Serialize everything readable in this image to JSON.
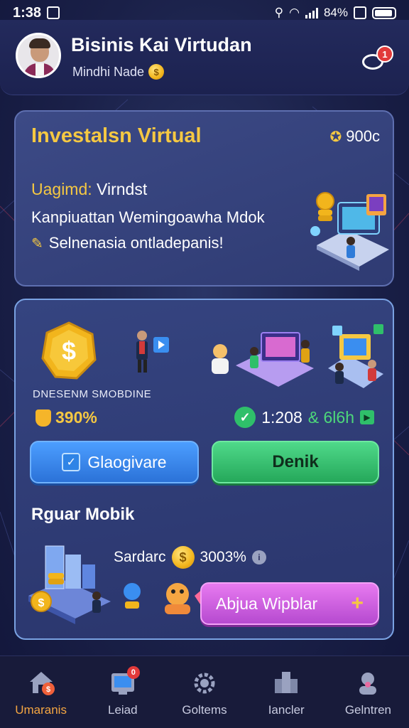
{
  "status_bar": {
    "time": "1:38",
    "battery_text": "84%"
  },
  "header": {
    "title": "Bisinis Kai Virtudan",
    "subtitle": "Mindhi Nade",
    "subtitle_coin": "$",
    "notification_count": "1"
  },
  "card_invest": {
    "title": "Investalsn Virtual",
    "coins": "900c",
    "label": "Uagimd:",
    "label_value": "Virndst",
    "line2": "Kanpiuattan Wemingoawha Mdok",
    "line3": "Selnenasia ontladepanis!"
  },
  "card_business": {
    "coin_symbol": "$",
    "label": "DNESENM SMOBDINE",
    "percent": "390%",
    "time_value": "1:208",
    "time_suffix": "& 6l6h",
    "btn_primary": "Glaogivare",
    "btn_secondary": "Denik",
    "sub_title": "Rguar Mobik",
    "saldo_label": "Sardarc",
    "saldo_value": "3003%",
    "saldo_coin": "$",
    "btn_add": "Abjua Wipblar",
    "btn_add_icon": "+"
  },
  "bottom_nav": {
    "items": [
      {
        "label": "Umaranis",
        "icon": "home-icon",
        "active": true
      },
      {
        "label": "Leiad",
        "icon": "screen-icon",
        "badge": "0"
      },
      {
        "label": "Goltems",
        "icon": "gear-icon"
      },
      {
        "label": "Iancler",
        "icon": "building-icon"
      },
      {
        "label": "Gelntren",
        "icon": "people-icon"
      }
    ]
  },
  "colors": {
    "accent_gold": "#f5c842",
    "primary_blue": "#3a8ef0",
    "success_green": "#2fbf6a",
    "pink": "#d05ee0",
    "badge_red": "#e23a3a"
  }
}
